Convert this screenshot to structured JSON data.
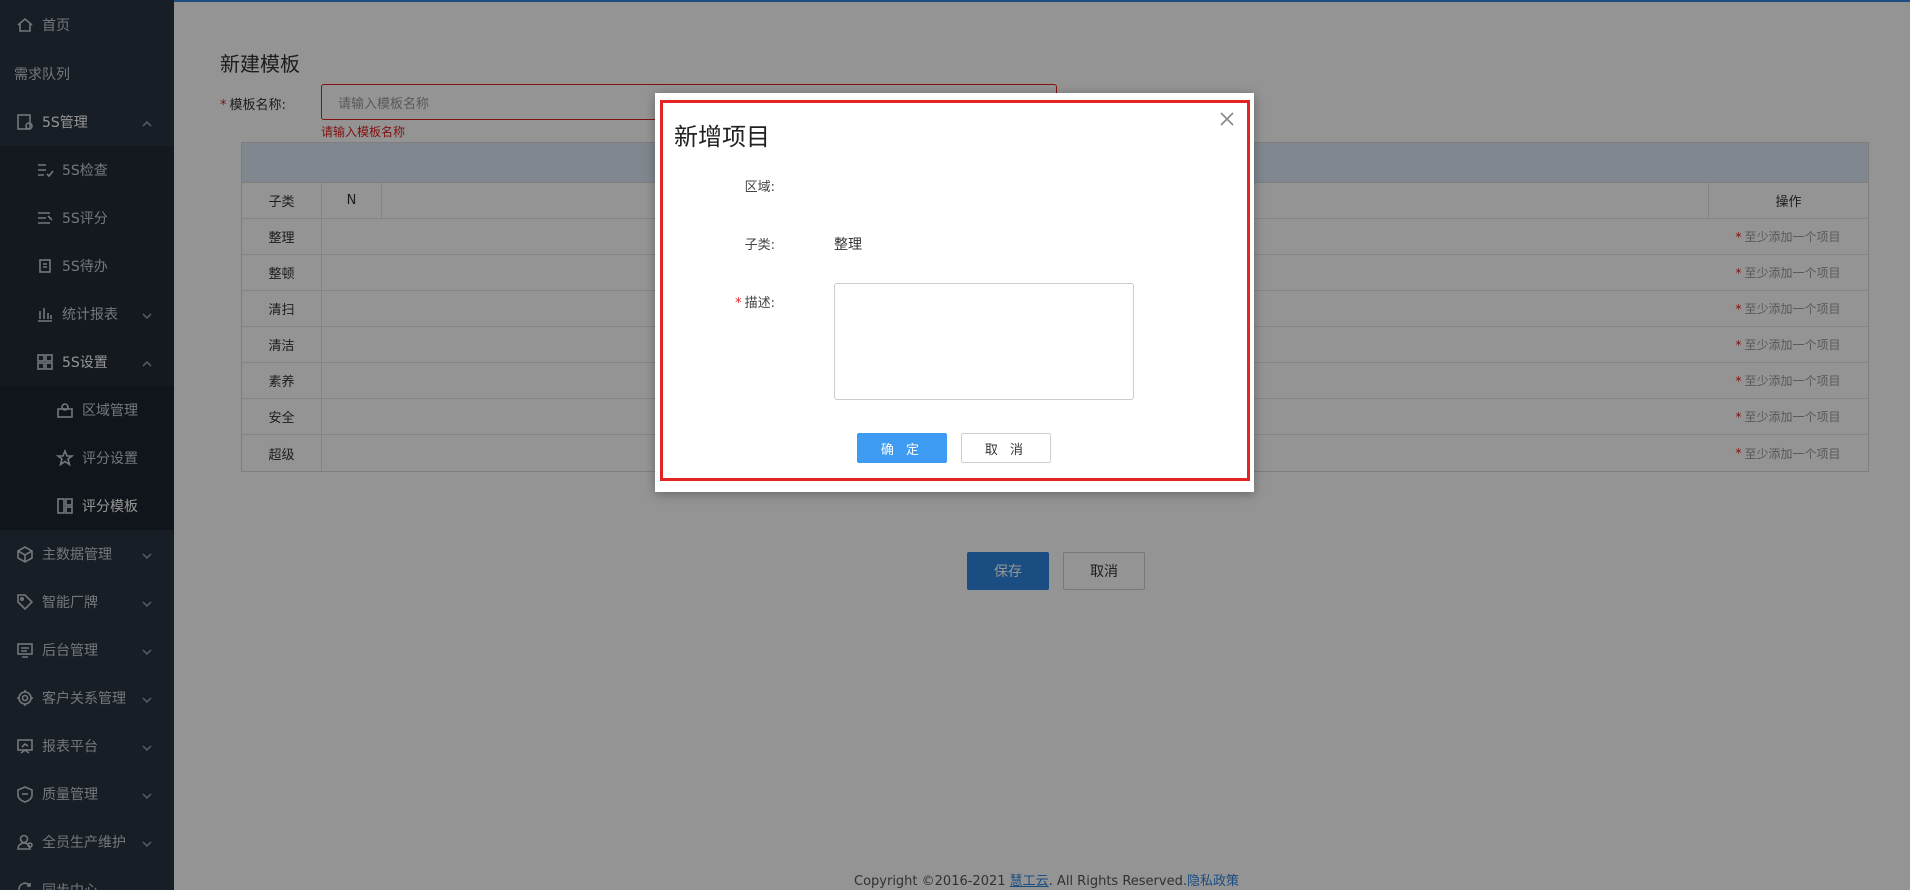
{
  "sidebar": {
    "items": [
      {
        "label": "首页",
        "icon": "home-icon"
      },
      {
        "label": "需求队列",
        "icon": ""
      },
      {
        "label": "5S管理",
        "icon": "5s-icon"
      },
      {
        "label": "5S检查",
        "icon": "checklist-icon"
      },
      {
        "label": "5S评分",
        "icon": "score-icon"
      },
      {
        "label": "5S待办",
        "icon": "todo-icon"
      },
      {
        "label": "统计报表",
        "icon": "bar-chart-icon"
      },
      {
        "label": "5S设置",
        "icon": "grid-icon"
      },
      {
        "label": "区域管理",
        "icon": "area-icon"
      },
      {
        "label": "评分设置",
        "icon": "star-icon"
      },
      {
        "label": "评分模板",
        "icon": "template-icon"
      },
      {
        "label": "主数据管理",
        "icon": "box-icon"
      },
      {
        "label": "智能厂牌",
        "icon": "tag-icon"
      },
      {
        "label": "后台管理",
        "icon": "monitor-icon"
      },
      {
        "label": "客户关系管理",
        "icon": "target-icon"
      },
      {
        "label": "报表平台",
        "icon": "report-icon"
      },
      {
        "label": "质量管理",
        "icon": "quality-icon"
      },
      {
        "label": "全员生产维护",
        "icon": "worker-icon"
      },
      {
        "label": "同步中心",
        "icon": "sync-icon"
      }
    ]
  },
  "page": {
    "title": "新建模板",
    "name_label": "模板名称:",
    "name_placeholder": "请输入模板名称",
    "name_error": "请输入模板名称",
    "save_label": "保存",
    "cancel_label": "取消"
  },
  "grid": {
    "headers": {
      "sub": "子类",
      "n": "N",
      "op": "操作"
    },
    "rows": [
      {
        "sub": "整理",
        "op": "至少添加一个项目"
      },
      {
        "sub": "整顿",
        "op": "至少添加一个项目"
      },
      {
        "sub": "清扫",
        "op": "至少添加一个项目"
      },
      {
        "sub": "清洁",
        "op": "至少添加一个项目"
      },
      {
        "sub": "素养",
        "op": "至少添加一个项目"
      },
      {
        "sub": "安全",
        "op": "至少添加一个项目"
      },
      {
        "sub": "超级",
        "op": "至少添加一个项目"
      }
    ]
  },
  "footer": {
    "prefix": "Copyright ©2016-2021 ",
    "brand": "慧工云",
    "middle": ". All Rights Reserved.",
    "privacy": "隐私政策"
  },
  "modal": {
    "title": "新增项目",
    "area_label": "区域:",
    "sub_label": "子类:",
    "sub_value": "整理",
    "desc_label": "描述:",
    "ok_label": "确 定",
    "cancel_label": "取 消"
  },
  "colors": {
    "sidebar_bg": "#2a3441",
    "accent": "#2e86e0",
    "error": "#e02020",
    "highlight": "#e32424"
  }
}
